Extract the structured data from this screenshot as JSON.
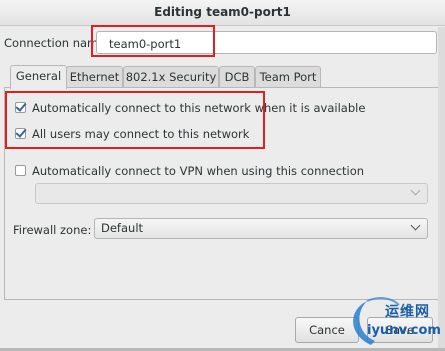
{
  "window": {
    "title": "Editing team0-port1"
  },
  "connection": {
    "label": "Connection name:",
    "value": "team0-port1"
  },
  "tabs": [
    {
      "label": "General",
      "active": true
    },
    {
      "label": "Ethernet",
      "active": false
    },
    {
      "label": "802.1x Security",
      "active": false
    },
    {
      "label": "DCB",
      "active": false
    },
    {
      "label": "Team Port",
      "active": false
    }
  ],
  "general": {
    "auto_connect": {
      "label": "Automatically connect to this network when it is available",
      "checked": true
    },
    "all_users": {
      "label": "All users may connect to this network",
      "checked": true
    },
    "auto_vpn": {
      "label": "Automatically connect to VPN when using this connection",
      "checked": false
    },
    "vpn_select": {
      "value": "",
      "enabled": false
    },
    "firewall": {
      "label": "Firewall zone:",
      "value": "Default"
    }
  },
  "buttons": {
    "cancel": "Cance",
    "save": "Save"
  },
  "watermark": {
    "cn": "运维网",
    "en": "iyunv.com"
  },
  "colors": {
    "highlight": "#e02020",
    "check": "#3465a4"
  }
}
